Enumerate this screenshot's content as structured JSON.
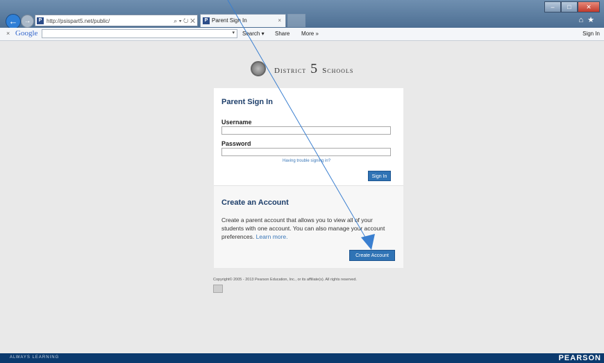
{
  "browser": {
    "address_url": "http://psispart5.net/public/",
    "address_tools": "⌕ ▾ ↻ ✕",
    "favicon_letter": "P",
    "tab_title": "Parent Sign In",
    "tab_close": "×",
    "window_buttons": [
      "–",
      "□",
      "✕"
    ],
    "nav_back_icon": "←",
    "nav_forward_icon": "→",
    "home_star_icons": "⌂★"
  },
  "google_bar": {
    "close": "×",
    "logo": "Google",
    "dropdown": "▾",
    "search_label": "Search ▾",
    "share_label": "Share",
    "more_label": "More »",
    "signin_label": "Sign In"
  },
  "logo": {
    "district": "District",
    "number": "5",
    "schools": "Schools"
  },
  "signin": {
    "title": "Parent Sign In",
    "username_label": "Username",
    "password_label": "Password",
    "trouble_link": "Having trouble signing in?",
    "signin_button": "Sign In"
  },
  "create_account": {
    "title": "Create an Account",
    "description": "Create a parent account that allows you to view all of your students with one account. You can also manage your account preferences.",
    "learn_more": "Learn more.",
    "button": "Create Account"
  },
  "copyright": "Copyright© 2005 - 2013 Pearson Education, Inc., or its affiliate(s). All rights reserved.",
  "footer": {
    "tagline": "ALWAYS LEARNING",
    "brand": "PEARSON"
  },
  "colors": {
    "accent": "#2f73b5",
    "heading": "#1d3e6a",
    "footer": "#0b3a6e",
    "annotation_arrow": "#3a7fd0"
  }
}
